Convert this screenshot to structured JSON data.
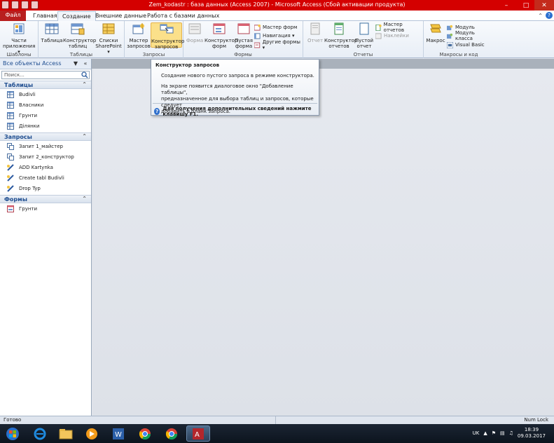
{
  "window": {
    "title": "Zem_kodastr : база данных (Access 2007)  -  Microsoft Access (Сбой активации продукта)"
  },
  "ribbon_tabs": [
    "Файл",
    "Главная",
    "Создание",
    "Внешние данные",
    "Работа с базами данных"
  ],
  "ribbon": {
    "groups": {
      "templates": {
        "label": "Шаблоны",
        "btn1": "Части",
        "btn2": "приложения ▾"
      },
      "tables": {
        "label": "Таблицы",
        "table": "Таблица",
        "constructor1": "Конструктор",
        "constructor2": "таблиц",
        "sp1": "Списки",
        "sp2": "SharePoint ▾"
      },
      "queries": {
        "label": "Запросы",
        "wizard1": "Мастер",
        "wizard2": "запросов",
        "design1": "Конструктор",
        "design2": "запросов"
      },
      "forms": {
        "label": "Формы",
        "form": "Форма",
        "fc1": "Конструктор",
        "fc2": "форм",
        "empty1": "Пустая",
        "empty2": "форма",
        "s1": "Мастер форм",
        "s2": "Навигация ▾",
        "s3": "Другие формы ▾"
      },
      "reports": {
        "label": "Отчеты",
        "report": "Отчет",
        "rc1": "Конструктор",
        "rc2": "отчетов",
        "er1": "Пустой",
        "er2": "отчет",
        "s1": "Мастер отчетов",
        "s2": "Наклейки"
      },
      "macros": {
        "label": "Макросы и код",
        "macro": "Макрос",
        "s1": "Модуль",
        "s2": "Модуль класса",
        "s3": "Visual Basic"
      }
    }
  },
  "nav": {
    "header": "Все объекты Access",
    "search_placeholder": "Поиск...",
    "sections": [
      {
        "title": "Таблицы",
        "items": [
          "Budivli",
          "Власники",
          "Грунти",
          "Ділянки"
        ]
      },
      {
        "title": "Запросы",
        "items": [
          "Запит 1_майстер",
          "Запит 2_конструктор",
          "ADD Kartynka",
          "Create tabl Budivli",
          "Drop Typ"
        ]
      },
      {
        "title": "Формы",
        "items": [
          "Грунти"
        ]
      }
    ]
  },
  "tooltip": {
    "title": "Конструктор запросов",
    "line1": "Создание нового пустого запроса в режиме конструктора.",
    "line2a": "На экране появится диалоговое окно \"Добавление таблицы\",",
    "line2b": "предназначенное для выбора таблиц и запросов, которые следует",
    "line2c": "добавить в бланк запроса.",
    "help": "Для получения дополнительных сведений нажмите клавишу F1."
  },
  "status": {
    "left": "Готово",
    "right": "Num Lock"
  },
  "taskbar": {
    "lang": "UK",
    "time": "18:39",
    "date": "09.03.2017"
  },
  "colors": {
    "titlebar": "#d40000",
    "file_tab": "#b81f1f",
    "highlight": "#fbe08a"
  }
}
